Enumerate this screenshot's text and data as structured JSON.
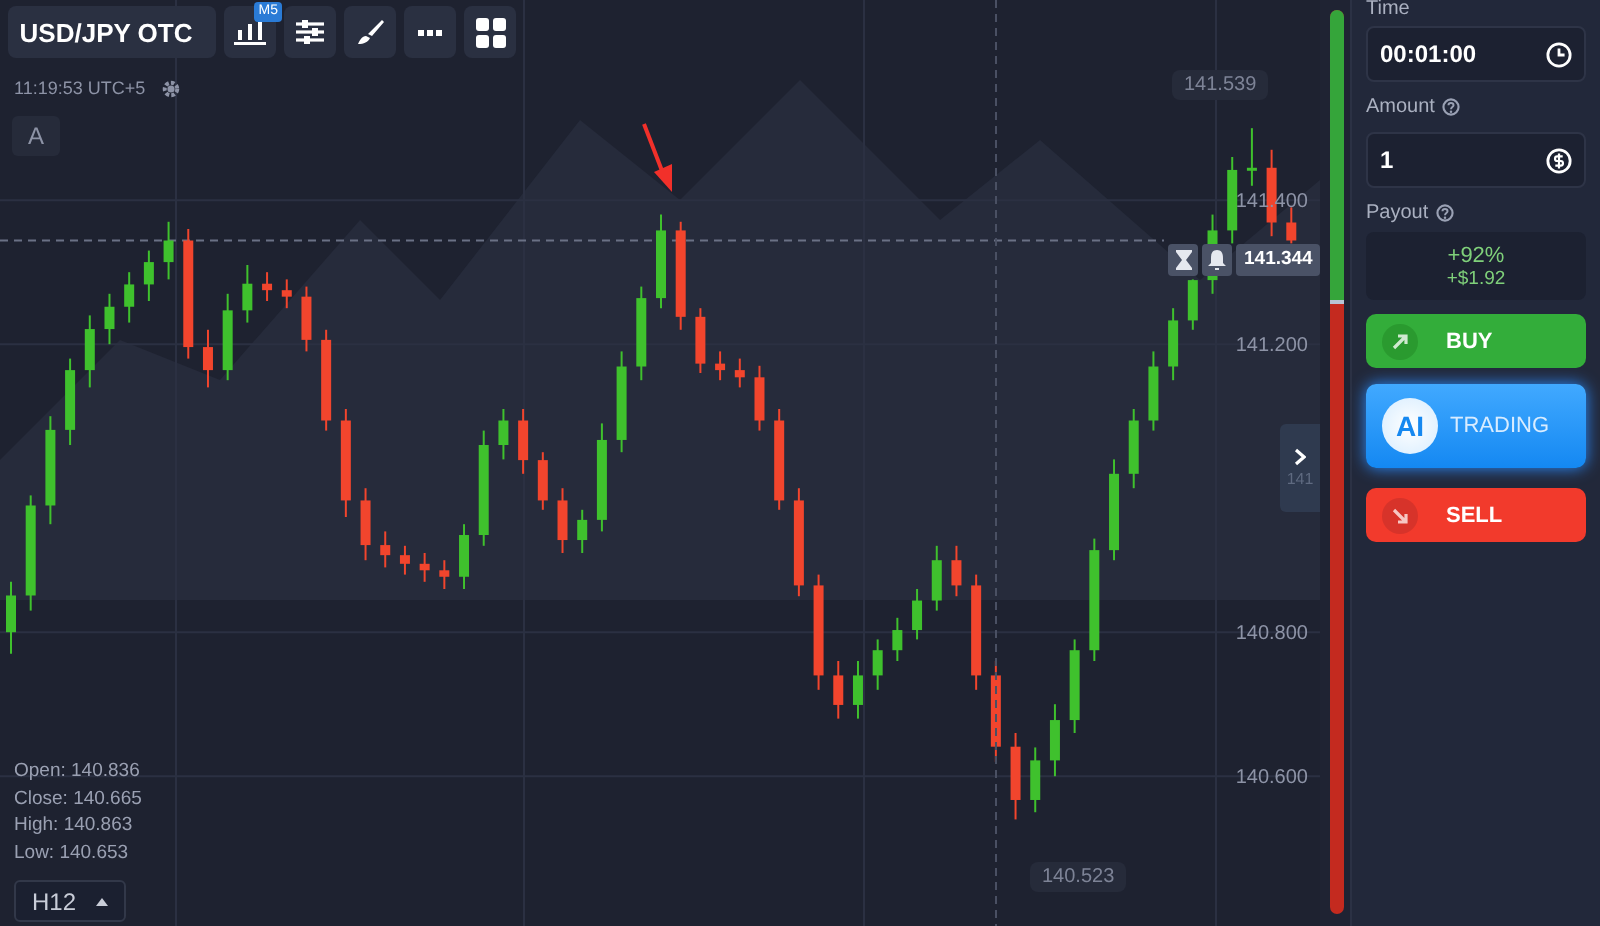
{
  "toolbar": {
    "asset": "USD/JPY OTC",
    "chart_badge": "M5"
  },
  "clock": "11:19:53 UTC+5",
  "draw_tool": "A",
  "chart": {
    "high_marker": "141.539",
    "low_marker": "140.523",
    "current_price": "141.344",
    "side_tab_text": "141",
    "chart_data": {
      "type": "candlestick",
      "grid": true,
      "ylim": [
        140.392,
        141.678
      ],
      "ref_lines": [
        {
          "axis": "y",
          "value": 141.344
        }
      ],
      "yticks": [
        {
          "value": 141.4,
          "label": "141.400"
        },
        {
          "value": 141.2,
          "label": "141.200"
        },
        {
          "value": 140.8,
          "label": "140.800"
        },
        {
          "value": 140.6,
          "label": "140.600"
        }
      ],
      "ohlc": [
        [
          140.8,
          140.87,
          140.77,
          140.851
        ],
        [
          140.851,
          140.99,
          140.83,
          140.976
        ],
        [
          140.976,
          141.1,
          140.95,
          141.081
        ],
        [
          141.081,
          141.18,
          141.06,
          141.164
        ],
        [
          141.164,
          141.24,
          141.14,
          141.221
        ],
        [
          141.221,
          141.27,
          141.2,
          141.252
        ],
        [
          141.252,
          141.3,
          141.23,
          141.283
        ],
        [
          141.283,
          141.33,
          141.26,
          141.314
        ],
        [
          141.314,
          141.37,
          141.29,
          141.344
        ],
        [
          141.344,
          141.36,
          141.18,
          141.196
        ],
        [
          141.196,
          141.22,
          141.14,
          141.164
        ],
        [
          141.164,
          141.27,
          141.15,
          141.247
        ],
        [
          141.247,
          141.31,
          141.23,
          141.284
        ],
        [
          141.284,
          141.3,
          141.26,
          141.275
        ],
        [
          141.275,
          141.29,
          141.25,
          141.266
        ],
        [
          141.266,
          141.28,
          141.19,
          141.206
        ],
        [
          141.206,
          141.22,
          141.08,
          141.094
        ],
        [
          141.094,
          141.11,
          140.96,
          140.983
        ],
        [
          140.983,
          141.0,
          140.9,
          140.921
        ],
        [
          140.921,
          140.94,
          140.89,
          140.907
        ],
        [
          140.907,
          140.92,
          140.88,
          140.895
        ],
        [
          140.895,
          140.91,
          140.87,
          140.886
        ],
        [
          140.886,
          140.9,
          140.86,
          140.877
        ],
        [
          140.877,
          140.95,
          140.86,
          140.935
        ],
        [
          140.935,
          141.08,
          140.92,
          141.06
        ],
        [
          141.06,
          141.11,
          141.04,
          141.094
        ],
        [
          141.094,
          141.11,
          141.02,
          141.039
        ],
        [
          141.039,
          141.05,
          140.97,
          140.983
        ],
        [
          140.983,
          141.0,
          140.91,
          140.928
        ],
        [
          140.928,
          140.97,
          140.91,
          140.956
        ],
        [
          140.956,
          141.09,
          140.94,
          141.067
        ],
        [
          141.067,
          141.19,
          141.05,
          141.169
        ],
        [
          141.169,
          141.28,
          141.15,
          141.264
        ],
        [
          141.264,
          141.38,
          141.25,
          141.358
        ],
        [
          141.358,
          141.37,
          141.22,
          141.238
        ],
        [
          141.238,
          141.25,
          141.16,
          141.173
        ],
        [
          141.173,
          141.19,
          141.15,
          141.164
        ],
        [
          141.164,
          141.18,
          141.14,
          141.154
        ],
        [
          141.154,
          141.17,
          141.08,
          141.094
        ],
        [
          141.094,
          141.11,
          140.97,
          140.983
        ],
        [
          140.983,
          141.0,
          140.85,
          140.865
        ],
        [
          140.865,
          140.88,
          140.72,
          140.74
        ],
        [
          140.74,
          140.76,
          140.68,
          140.699
        ],
        [
          140.699,
          140.76,
          140.68,
          140.74
        ],
        [
          140.74,
          140.79,
          140.72,
          140.775
        ],
        [
          140.775,
          140.82,
          140.76,
          140.803
        ],
        [
          140.803,
          140.86,
          140.79,
          140.844
        ],
        [
          140.844,
          140.92,
          140.83,
          140.9
        ],
        [
          140.9,
          140.92,
          140.85,
          140.865
        ],
        [
          140.865,
          140.88,
          140.72,
          140.74
        ],
        [
          140.74,
          140.76,
          140.62,
          140.641
        ],
        [
          140.641,
          140.66,
          140.54,
          140.567
        ],
        [
          140.567,
          140.64,
          140.55,
          140.622
        ],
        [
          140.622,
          140.7,
          140.6,
          140.678
        ],
        [
          140.678,
          140.79,
          140.66,
          140.775
        ],
        [
          140.775,
          140.93,
          140.76,
          140.914
        ],
        [
          140.914,
          141.04,
          140.9,
          141.02
        ],
        [
          141.02,
          141.11,
          141.0,
          141.094
        ],
        [
          141.094,
          141.19,
          141.08,
          141.169
        ],
        [
          141.169,
          141.25,
          141.15,
          141.233
        ],
        [
          141.233,
          141.29,
          141.22,
          141.289
        ],
        [
          141.289,
          141.38,
          141.27,
          141.358
        ],
        [
          141.358,
          141.46,
          141.34,
          141.442
        ],
        [
          141.442,
          141.5,
          141.42,
          141.445
        ],
        [
          141.445,
          141.47,
          141.35,
          141.369
        ],
        [
          141.369,
          141.39,
          141.34,
          141.344
        ]
      ]
    }
  },
  "ohlc": [
    "Open: 140.836",
    "Close: 140.665",
    "High: 140.863",
    "Low: 140.653"
  ],
  "timeframe": "H12",
  "sentiment": {
    "level": 0.32
  },
  "panel": {
    "time": {
      "label": "Time",
      "value": "00:01:00"
    },
    "amount": {
      "label": "Amount",
      "value": "1"
    },
    "payout": {
      "label": "Payout",
      "percent": "+92%",
      "profit": "+$1.92"
    },
    "buttons": [
      {
        "kind": "buy",
        "label": "BUY"
      },
      {
        "kind": "ai",
        "badge": "AI",
        "label": "TRADING"
      },
      {
        "kind": "sell",
        "label": "SELL"
      }
    ]
  }
}
